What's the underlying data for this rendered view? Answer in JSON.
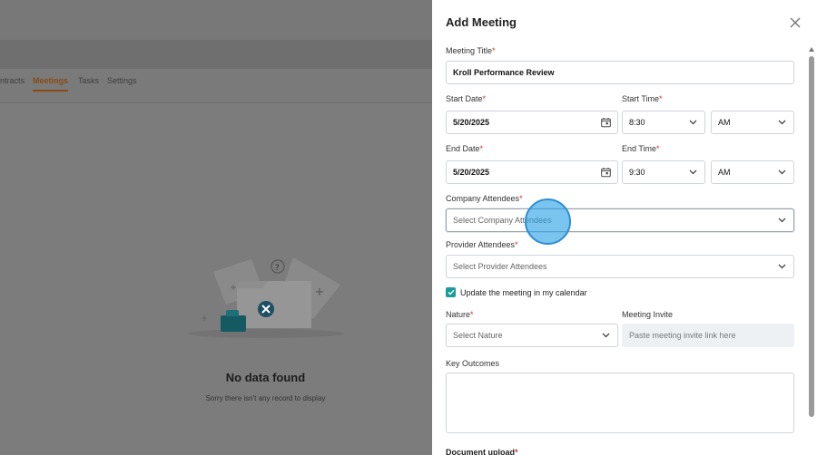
{
  "background": {
    "tabs": [
      "ntracts",
      "Meetings",
      "Tasks",
      "Settings"
    ],
    "active_tab": "Meetings",
    "empty_title": "No data found",
    "empty_subtitle": "Sorry there isn't any record to display"
  },
  "drawer": {
    "title": "Add Meeting",
    "close_icon": "close-icon",
    "meeting_title": {
      "label": "Meeting Title",
      "value": "Kroll Performance Review"
    },
    "start_date": {
      "label": "Start Date",
      "value": "5/20/2025"
    },
    "start_time": {
      "label": "Start Time",
      "value": "8:30",
      "period": "AM"
    },
    "end_date": {
      "label": "End Date",
      "value": "5/20/2025"
    },
    "end_time": {
      "label": "End Time",
      "value": "9:30",
      "period": "AM"
    },
    "company_attendees": {
      "label": "Company Attendees",
      "placeholder": "Select Company Attendees"
    },
    "provider_attendees": {
      "label": "Provider Attendees",
      "placeholder": "Select Provider Attendees"
    },
    "calendar_checkbox": {
      "label": "Update the meeting in my calendar",
      "checked": true
    },
    "nature": {
      "label": "Nature",
      "placeholder": "Select Nature"
    },
    "meeting_invite": {
      "label": "Meeting Invite",
      "placeholder": "Paste meeting invite link here"
    },
    "key_outcomes": {
      "label": "Key Outcomes"
    },
    "document_upload": {
      "label": "Document upload"
    },
    "required_marker": "*"
  },
  "colors": {
    "accent": "#1a9c9c",
    "required": "#d32f2f",
    "active_tab": "#c96a1a",
    "cursor": "#2c8fd1"
  }
}
